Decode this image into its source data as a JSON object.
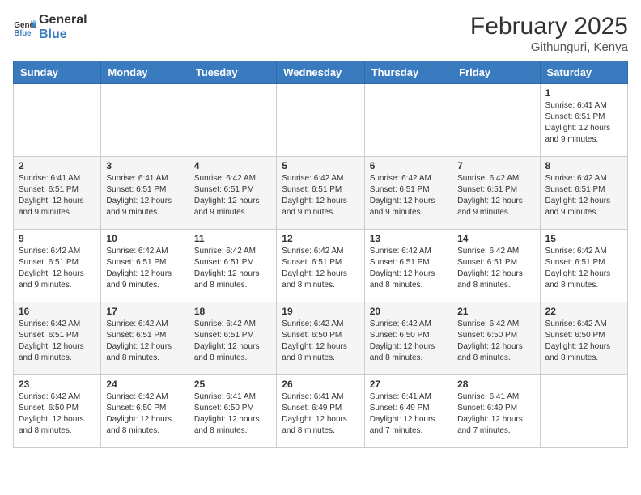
{
  "header": {
    "logo_line1": "General",
    "logo_line2": "Blue",
    "month_title": "February 2025",
    "location": "Githunguri, Kenya"
  },
  "weekdays": [
    "Sunday",
    "Monday",
    "Tuesday",
    "Wednesday",
    "Thursday",
    "Friday",
    "Saturday"
  ],
  "weeks": [
    [
      {
        "day": "",
        "info": ""
      },
      {
        "day": "",
        "info": ""
      },
      {
        "day": "",
        "info": ""
      },
      {
        "day": "",
        "info": ""
      },
      {
        "day": "",
        "info": ""
      },
      {
        "day": "",
        "info": ""
      },
      {
        "day": "1",
        "info": "Sunrise: 6:41 AM\nSunset: 6:51 PM\nDaylight: 12 hours\nand 9 minutes."
      }
    ],
    [
      {
        "day": "2",
        "info": "Sunrise: 6:41 AM\nSunset: 6:51 PM\nDaylight: 12 hours\nand 9 minutes."
      },
      {
        "day": "3",
        "info": "Sunrise: 6:41 AM\nSunset: 6:51 PM\nDaylight: 12 hours\nand 9 minutes."
      },
      {
        "day": "4",
        "info": "Sunrise: 6:42 AM\nSunset: 6:51 PM\nDaylight: 12 hours\nand 9 minutes."
      },
      {
        "day": "5",
        "info": "Sunrise: 6:42 AM\nSunset: 6:51 PM\nDaylight: 12 hours\nand 9 minutes."
      },
      {
        "day": "6",
        "info": "Sunrise: 6:42 AM\nSunset: 6:51 PM\nDaylight: 12 hours\nand 9 minutes."
      },
      {
        "day": "7",
        "info": "Sunrise: 6:42 AM\nSunset: 6:51 PM\nDaylight: 12 hours\nand 9 minutes."
      },
      {
        "day": "8",
        "info": "Sunrise: 6:42 AM\nSunset: 6:51 PM\nDaylight: 12 hours\nand 9 minutes."
      }
    ],
    [
      {
        "day": "9",
        "info": "Sunrise: 6:42 AM\nSunset: 6:51 PM\nDaylight: 12 hours\nand 9 minutes."
      },
      {
        "day": "10",
        "info": "Sunrise: 6:42 AM\nSunset: 6:51 PM\nDaylight: 12 hours\nand 9 minutes."
      },
      {
        "day": "11",
        "info": "Sunrise: 6:42 AM\nSunset: 6:51 PM\nDaylight: 12 hours\nand 8 minutes."
      },
      {
        "day": "12",
        "info": "Sunrise: 6:42 AM\nSunset: 6:51 PM\nDaylight: 12 hours\nand 8 minutes."
      },
      {
        "day": "13",
        "info": "Sunrise: 6:42 AM\nSunset: 6:51 PM\nDaylight: 12 hours\nand 8 minutes."
      },
      {
        "day": "14",
        "info": "Sunrise: 6:42 AM\nSunset: 6:51 PM\nDaylight: 12 hours\nand 8 minutes."
      },
      {
        "day": "15",
        "info": "Sunrise: 6:42 AM\nSunset: 6:51 PM\nDaylight: 12 hours\nand 8 minutes."
      }
    ],
    [
      {
        "day": "16",
        "info": "Sunrise: 6:42 AM\nSunset: 6:51 PM\nDaylight: 12 hours\nand 8 minutes."
      },
      {
        "day": "17",
        "info": "Sunrise: 6:42 AM\nSunset: 6:51 PM\nDaylight: 12 hours\nand 8 minutes."
      },
      {
        "day": "18",
        "info": "Sunrise: 6:42 AM\nSunset: 6:51 PM\nDaylight: 12 hours\nand 8 minutes."
      },
      {
        "day": "19",
        "info": "Sunrise: 6:42 AM\nSunset: 6:50 PM\nDaylight: 12 hours\nand 8 minutes."
      },
      {
        "day": "20",
        "info": "Sunrise: 6:42 AM\nSunset: 6:50 PM\nDaylight: 12 hours\nand 8 minutes."
      },
      {
        "day": "21",
        "info": "Sunrise: 6:42 AM\nSunset: 6:50 PM\nDaylight: 12 hours\nand 8 minutes."
      },
      {
        "day": "22",
        "info": "Sunrise: 6:42 AM\nSunset: 6:50 PM\nDaylight: 12 hours\nand 8 minutes."
      }
    ],
    [
      {
        "day": "23",
        "info": "Sunrise: 6:42 AM\nSunset: 6:50 PM\nDaylight: 12 hours\nand 8 minutes."
      },
      {
        "day": "24",
        "info": "Sunrise: 6:42 AM\nSunset: 6:50 PM\nDaylight: 12 hours\nand 8 minutes."
      },
      {
        "day": "25",
        "info": "Sunrise: 6:41 AM\nSunset: 6:50 PM\nDaylight: 12 hours\nand 8 minutes."
      },
      {
        "day": "26",
        "info": "Sunrise: 6:41 AM\nSunset: 6:49 PM\nDaylight: 12 hours\nand 8 minutes."
      },
      {
        "day": "27",
        "info": "Sunrise: 6:41 AM\nSunset: 6:49 PM\nDaylight: 12 hours\nand 7 minutes."
      },
      {
        "day": "28",
        "info": "Sunrise: 6:41 AM\nSunset: 6:49 PM\nDaylight: 12 hours\nand 7 minutes."
      },
      {
        "day": "",
        "info": ""
      }
    ]
  ]
}
